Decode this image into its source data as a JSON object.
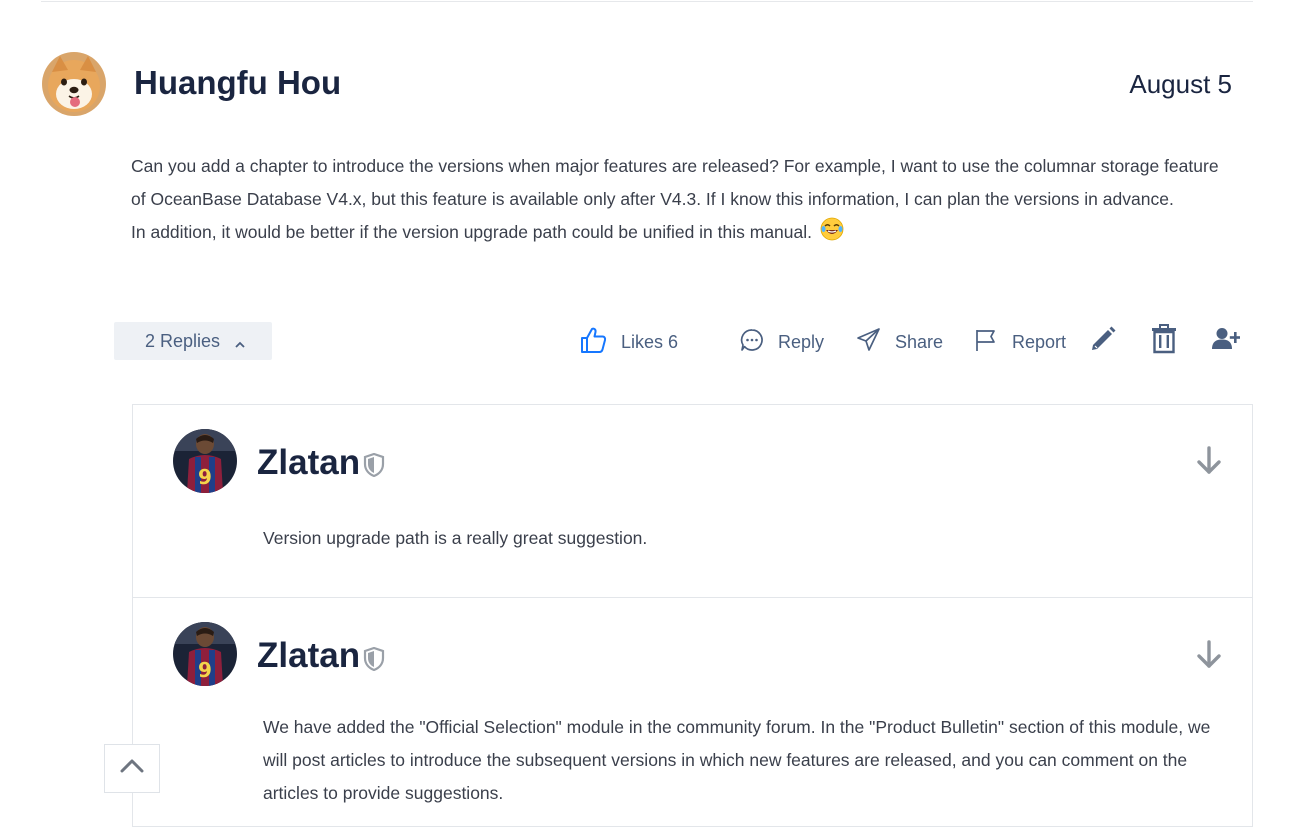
{
  "post": {
    "author": "Huangfu Hou",
    "date": "August 5",
    "body_line1": "Can you add a chapter to introduce the versions when major features are released? For example, I want to use the columnar storage feature of OceanBase Database V4.x, but this feature is available only after V4.3. If I know this information, I can plan the versions in advance.",
    "body_line2": "In addition, it would be better if the version upgrade path could be unified in this manual.",
    "emoji": "laughing-tears-emoji"
  },
  "actions": {
    "replies_label": "2 Replies",
    "likes_label": "Likes 6",
    "reply_label": "Reply",
    "share_label": "Share",
    "report_label": "Report"
  },
  "replies": [
    {
      "author": "Zlatan",
      "text": "Version upgrade path is a really great suggestion."
    },
    {
      "author": "Zlatan",
      "text": "We have added the \"Official Selection\" module in the community forum. In the \"Product Bulletin\" section of this module, we will post articles to introduce the subsequent versions in which new features are released, and you can comment on the articles to provide suggestions."
    }
  ],
  "colors": {
    "accent": "#1677ff",
    "text_dark": "#1a2540",
    "action_text": "#4a5f80"
  }
}
